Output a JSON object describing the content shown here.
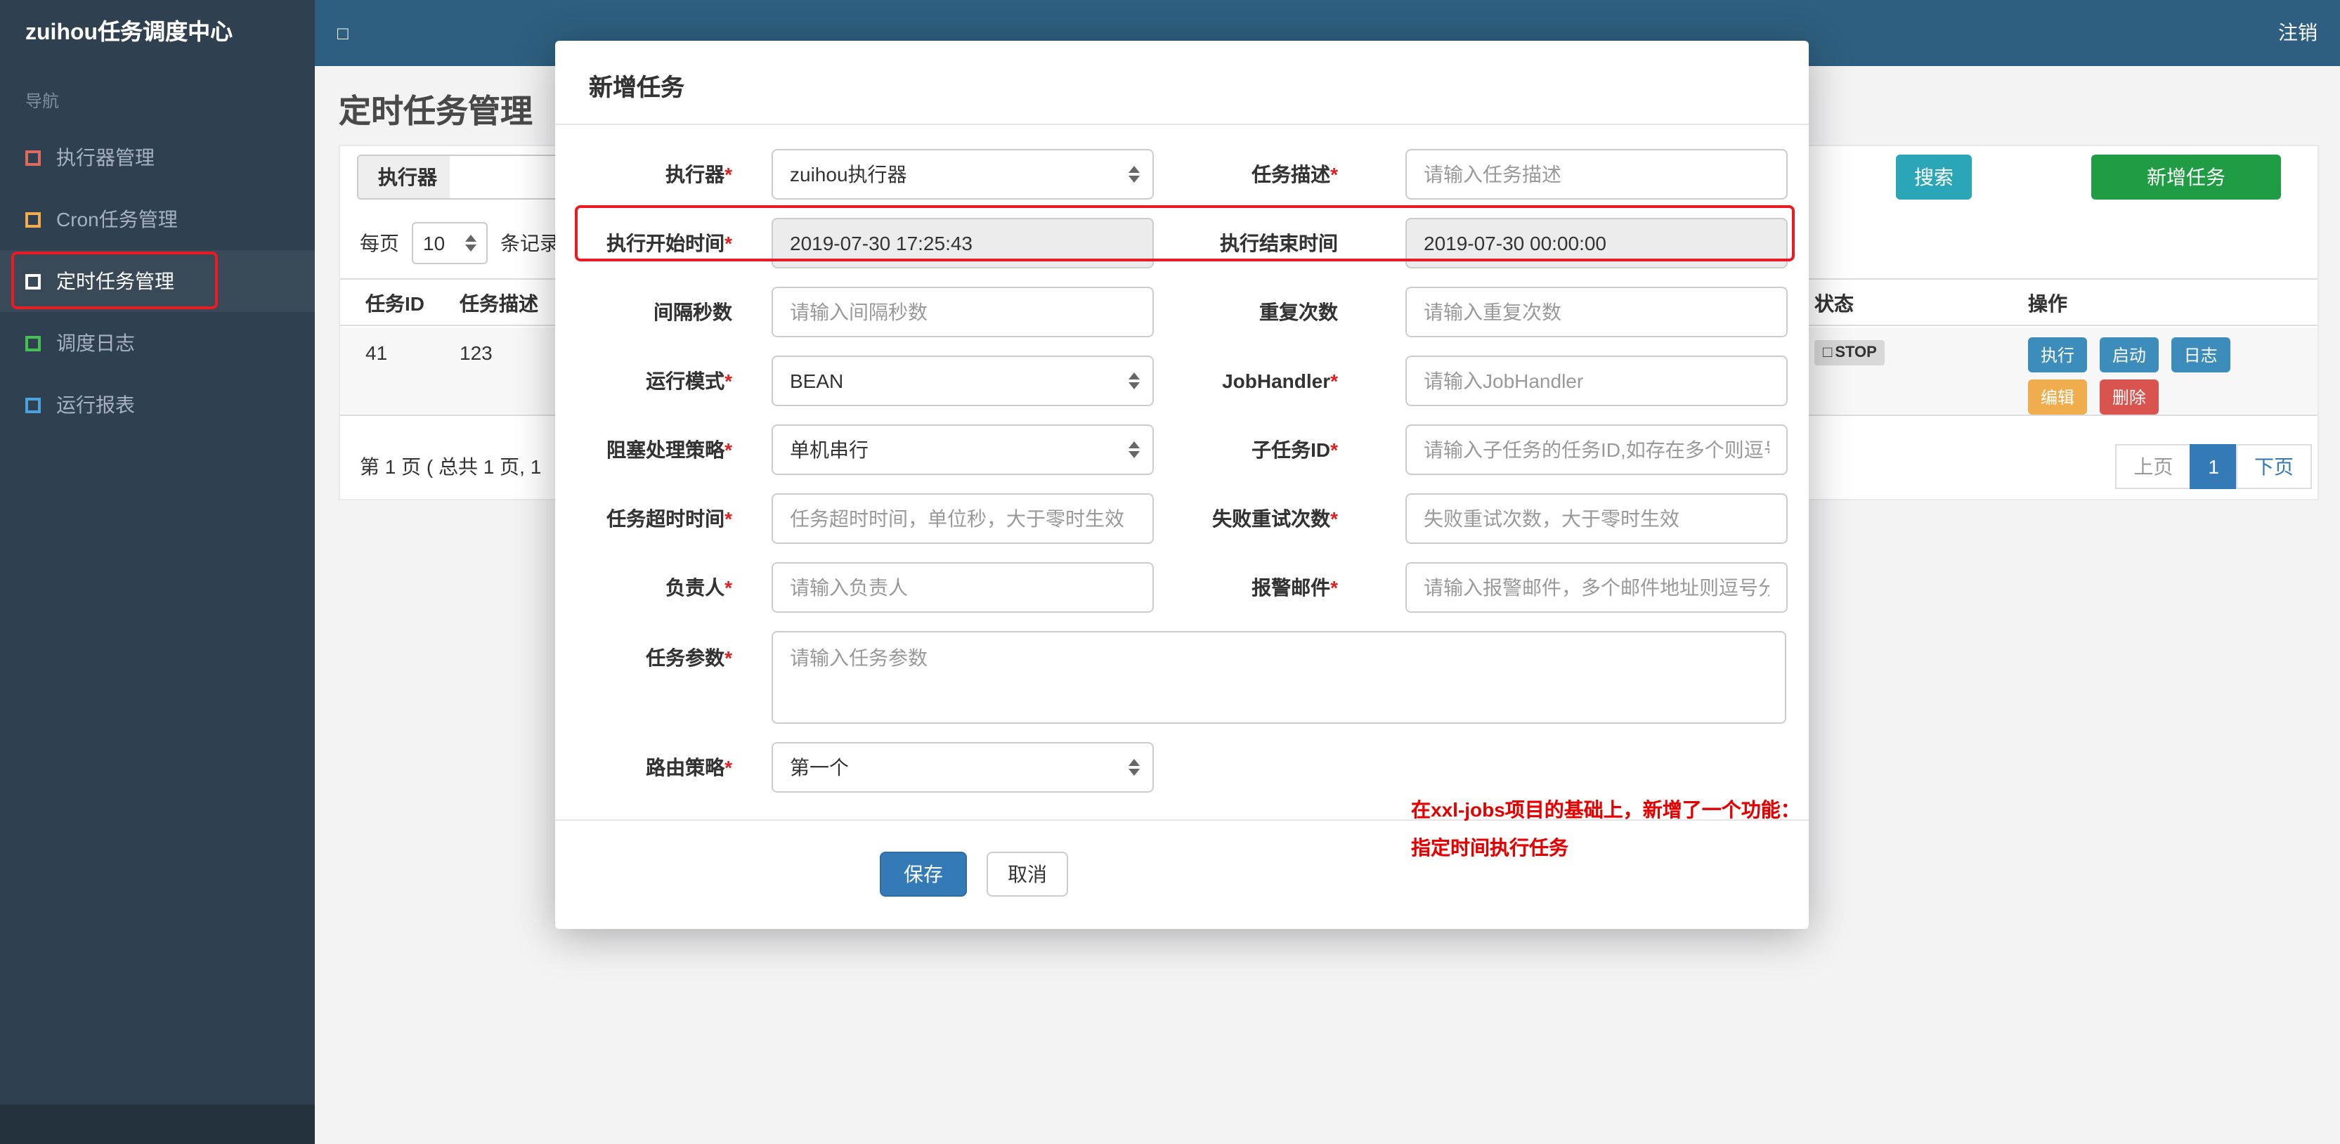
{
  "theme": {
    "topbar_blue": "#2e5f80",
    "sidebar_dark": "#2f4050",
    "accent_primary": "#337ab7",
    "btn_search": "#2ba6b8",
    "btn_add": "#209d44",
    "btn_warning": "#f0ad4e",
    "btn_danger": "#d9534f",
    "annotation_red": "#ea1b22"
  },
  "topbar": {
    "brand": "zuihou任务调度中心",
    "toggle_icon": "□",
    "logout": "注销"
  },
  "sidebar": {
    "nav_label": "导航",
    "items": [
      {
        "label": "执行器管理"
      },
      {
        "label": "Cron任务管理"
      },
      {
        "label": "定时任务管理"
      },
      {
        "label": "调度日志"
      },
      {
        "label": "运行报表"
      }
    ]
  },
  "page": {
    "title": "定时任务管理",
    "filter": {
      "executor_label": "执行器",
      "search": "搜索",
      "add": "新增任务"
    },
    "per_page": {
      "prefix": "每页",
      "value": "10",
      "suffix": "条记录"
    },
    "table": {
      "col_id": "任务ID",
      "col_desc": "任务描述",
      "col_status": "状态",
      "col_actions": "操作",
      "row": {
        "id": "41",
        "desc": "123",
        "status_icon": "□",
        "status": "STOP",
        "btn_execute": "执行",
        "btn_start": "启动",
        "btn_log": "日志",
        "btn_edit": "编辑",
        "btn_delete": "删除"
      }
    },
    "pagination": {
      "summary": "第 1 页 ( 总共 1 页, 1",
      "prev": "上页",
      "current": "1",
      "next": "下页"
    }
  },
  "modal": {
    "title": "新增任务",
    "rows": [
      {
        "left": {
          "label": "执行器",
          "star": "*",
          "value": "zuihou执行器"
        },
        "right": {
          "label": "任务描述",
          "star": "*",
          "placeholder": "请输入任务描述"
        }
      },
      {
        "left": {
          "label": "执行开始时间",
          "star": "*",
          "value": "2019-07-30 17:25:43"
        },
        "right": {
          "label": "执行结束时间",
          "star": "",
          "value": "2019-07-30 00:00:00"
        }
      },
      {
        "left": {
          "label": "间隔秒数",
          "star": "",
          "placeholder": "请输入间隔秒数"
        },
        "right": {
          "label": "重复次数",
          "star": "",
          "placeholder": "请输入重复次数"
        }
      },
      {
        "left": {
          "label": "运行模式",
          "star": "*",
          "value": "BEAN"
        },
        "right": {
          "label": "JobHandler",
          "star": "*",
          "placeholder": "请输入JobHandler"
        }
      },
      {
        "left": {
          "label": "阻塞处理策略",
          "star": "*",
          "value": "单机串行"
        },
        "right": {
          "label": "子任务ID",
          "star": "*",
          "placeholder": "请输入子任务的任务ID,如存在多个则逗号分隔"
        }
      },
      {
        "left": {
          "label": "任务超时时间",
          "star": "*",
          "placeholder": "任务超时时间，单位秒，大于零时生效"
        },
        "right": {
          "label": "失败重试次数",
          "star": "*",
          "placeholder": "失败重试次数，大于零时生效"
        }
      },
      {
        "left": {
          "label": "负责人",
          "star": "*",
          "placeholder": "请输入负责人"
        },
        "right": {
          "label": "报警邮件",
          "star": "*",
          "placeholder": "请输入报警邮件，多个邮件地址则逗号分隔"
        }
      }
    ],
    "params": {
      "label": "任务参数",
      "star": "*",
      "placeholder": "请输入任务参数"
    },
    "route": {
      "label": "路由策略",
      "star": "*",
      "value": "第一个"
    },
    "note_line1": "在xxl-jobs项目的基础上，新增了一个功能：",
    "note_line2": "指定时间执行任务",
    "save": "保存",
    "cancel": "取消"
  }
}
